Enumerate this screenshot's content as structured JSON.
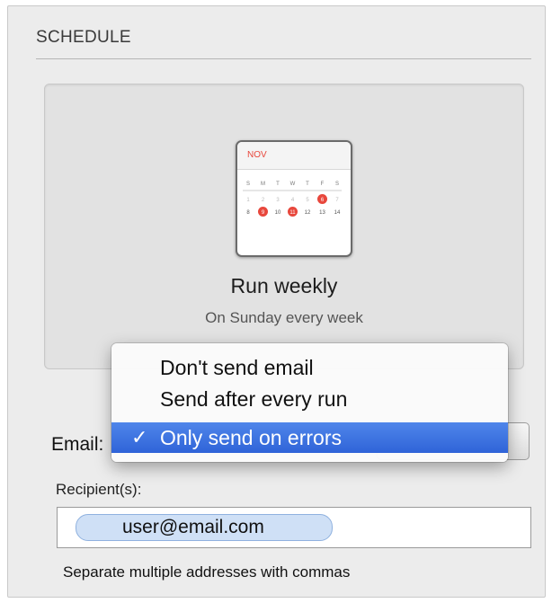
{
  "section": {
    "title": "SCHEDULE"
  },
  "schedule": {
    "calendar": {
      "month": "NOV",
      "weekdays": [
        "S",
        "M",
        "T",
        "W",
        "T",
        "F",
        "S"
      ],
      "rows": [
        [
          "1",
          "2",
          "3",
          "4",
          "5",
          "6",
          "7"
        ],
        [
          "8",
          "9",
          "10",
          "11",
          "12",
          "13",
          "14"
        ]
      ],
      "highlighted": [
        "6",
        "9",
        "11"
      ],
      "accent_color": "#e8473c"
    },
    "title": "Run weekly",
    "subtitle": "On Sunday every week"
  },
  "email": {
    "label": "Email:",
    "options": [
      "Don't send email",
      "Send after every run",
      "Only send on errors"
    ],
    "selected": "Only send on errors",
    "check_glyph": "✓",
    "highlight_color": "#2f63d8"
  },
  "recipients": {
    "label": "Recipient(s):",
    "tokens": [
      "user@email.com"
    ],
    "help": "Separate multiple addresses with commas"
  }
}
